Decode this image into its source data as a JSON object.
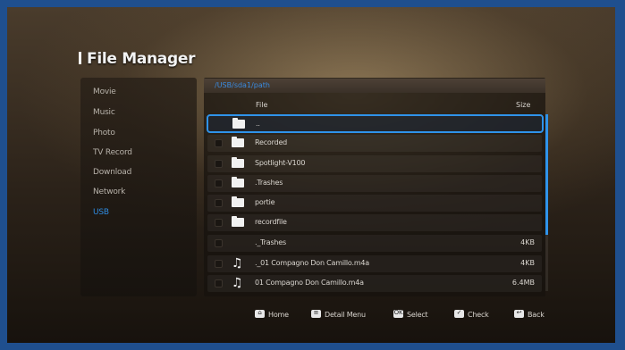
{
  "app": {
    "title": "File Manager"
  },
  "sidebar": {
    "items": [
      {
        "label": "Movie",
        "active": false
      },
      {
        "label": "Music",
        "active": false
      },
      {
        "label": "Photo",
        "active": false
      },
      {
        "label": "TV Record",
        "active": false
      },
      {
        "label": "Download",
        "active": false
      },
      {
        "label": "Network",
        "active": false
      },
      {
        "label": "USB",
        "active": true
      }
    ]
  },
  "browser": {
    "path": "/USB/sda1/path",
    "columns": {
      "file": "File",
      "size": "Size"
    },
    "rows": [
      {
        "type": "folder",
        "name": "..",
        "size": "",
        "selected": true,
        "checkbox": false
      },
      {
        "type": "folder",
        "name": "Recorded",
        "size": "",
        "selected": false,
        "checkbox": true
      },
      {
        "type": "folder",
        "name": "Spotlight-V100",
        "size": "",
        "selected": false,
        "checkbox": true
      },
      {
        "type": "folder",
        "name": ".Trashes",
        "size": "",
        "selected": false,
        "checkbox": true
      },
      {
        "type": "folder",
        "name": "portie",
        "size": "",
        "selected": false,
        "checkbox": true
      },
      {
        "type": "folder",
        "name": "recordfile",
        "size": "",
        "selected": false,
        "checkbox": true
      },
      {
        "type": "file",
        "name": "._Trashes",
        "size": "4KB",
        "selected": false,
        "checkbox": true
      },
      {
        "type": "music",
        "name": "._01 Compagno Don Camillo.m4a",
        "size": "4KB",
        "selected": false,
        "checkbox": true
      },
      {
        "type": "music",
        "name": "01 Compagno Don Camillo.m4a",
        "size": "6.4MB",
        "selected": false,
        "checkbox": true
      }
    ],
    "scroll_fraction_visible": 0.68
  },
  "footer": {
    "actions": [
      {
        "key_icon": "home-key-icon",
        "glyph": "⌂",
        "label": "Home"
      },
      {
        "key_icon": "menu-key-icon",
        "glyph": "≡",
        "label": "Detail Menu"
      },
      {
        "key_icon": "ok-key-icon",
        "glyph": "OK",
        "label": "Select"
      },
      {
        "key_icon": "check-key-icon",
        "glyph": "✓",
        "label": "Check"
      },
      {
        "key_icon": "back-key-icon",
        "glyph": "↩",
        "label": "Back"
      }
    ]
  },
  "colors": {
    "accent": "#2f93ea",
    "frame": "#1f4f8e",
    "text": "#d9d5cf"
  }
}
